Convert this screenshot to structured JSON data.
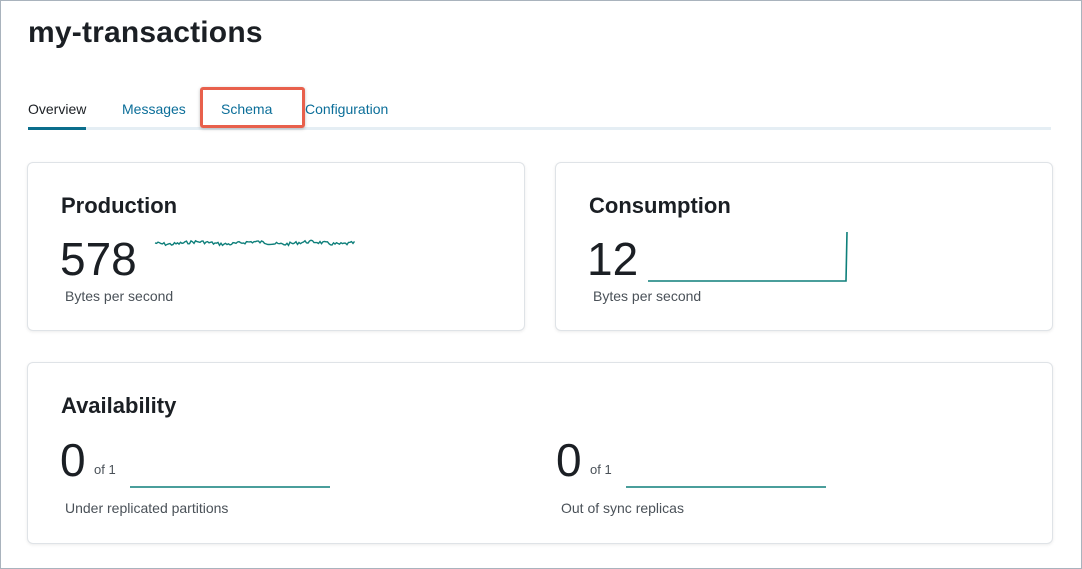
{
  "page": {
    "title": "my-transactions"
  },
  "tabs": [
    {
      "label": "Overview",
      "active": true
    },
    {
      "label": "Messages",
      "active": false
    },
    {
      "label": "Schema",
      "active": false,
      "highlighted": true
    },
    {
      "label": "Configuration",
      "active": false
    }
  ],
  "production": {
    "title": "Production",
    "value": "578",
    "unit": "Bytes per second"
  },
  "consumption": {
    "title": "Consumption",
    "value": "12",
    "unit": "Bytes per second"
  },
  "availability": {
    "title": "Availability",
    "under_replicated": {
      "value": "0",
      "of": "of 1",
      "label": "Under replicated partitions"
    },
    "out_of_sync": {
      "value": "0",
      "of": "of 1",
      "label": "Out of sync replicas"
    }
  },
  "colors": {
    "accent": "#0b6e99",
    "sparkline": "#0e7f7a",
    "highlight": "#e8604c"
  }
}
